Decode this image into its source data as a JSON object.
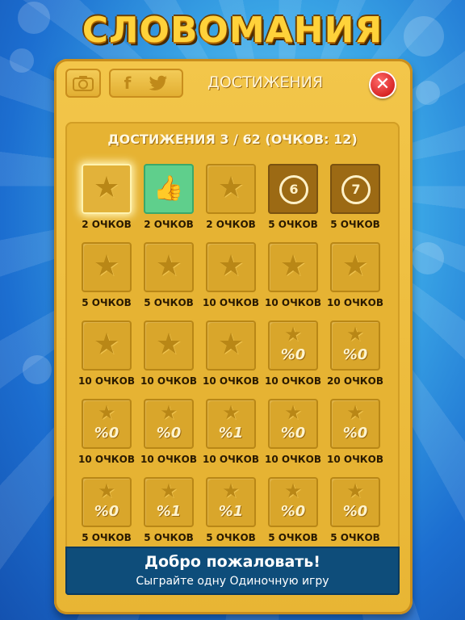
{
  "app": {
    "title": "СЛОВОМАНИЯ"
  },
  "panel": {
    "heading": "ДОСТИЖЕНИЯ",
    "summary": "ДОСТИЖЕНИЯ 3 / 62 (ОЧКОВ: 12)",
    "buttons": {
      "camera_icon": "camera-icon",
      "facebook_icon": "facebook-icon",
      "twitter_icon": "twitter-icon",
      "close_icon": "close-icon"
    }
  },
  "achievements": [
    {
      "type": "star",
      "points": "2 ОЧКОВ",
      "state": "highlighted"
    },
    {
      "type": "thumb",
      "points": "2 ОЧКОВ",
      "state": "unlocked"
    },
    {
      "type": "star",
      "points": "2 ОЧКОВ",
      "state": "locked"
    },
    {
      "type": "number",
      "number": "6",
      "points": "5 ОЧКОВ",
      "state": "unlocked"
    },
    {
      "type": "number",
      "number": "7",
      "points": "5 ОЧКОВ",
      "state": "unlocked"
    },
    {
      "type": "star",
      "points": "5 ОЧКОВ",
      "state": "locked"
    },
    {
      "type": "star",
      "points": "5 ОЧКОВ",
      "state": "locked"
    },
    {
      "type": "star",
      "points": "10 ОЧКОВ",
      "state": "locked"
    },
    {
      "type": "star",
      "points": "10 ОЧКОВ",
      "state": "locked"
    },
    {
      "type": "star",
      "points": "10 ОЧКОВ",
      "state": "locked"
    },
    {
      "type": "star",
      "points": "10 ОЧКОВ",
      "state": "locked"
    },
    {
      "type": "star",
      "points": "10 ОЧКОВ",
      "state": "locked"
    },
    {
      "type": "star",
      "points": "10 ОЧКОВ",
      "state": "locked"
    },
    {
      "type": "progress",
      "progress": "%0",
      "points": "10 ОЧКОВ",
      "state": "locked"
    },
    {
      "type": "progress",
      "progress": "%0",
      "points": "20 ОЧКОВ",
      "state": "locked"
    },
    {
      "type": "progress",
      "progress": "%0",
      "points": "10 ОЧКОВ",
      "state": "locked"
    },
    {
      "type": "progress",
      "progress": "%0",
      "points": "10 ОЧКОВ",
      "state": "locked"
    },
    {
      "type": "progress",
      "progress": "%1",
      "points": "10 ОЧКОВ",
      "state": "locked"
    },
    {
      "type": "progress",
      "progress": "%0",
      "points": "10 ОЧКОВ",
      "state": "locked"
    },
    {
      "type": "progress",
      "progress": "%0",
      "points": "10 ОЧКОВ",
      "state": "locked"
    },
    {
      "type": "progress",
      "progress": "%0",
      "points": "5 ОЧКОВ",
      "state": "locked"
    },
    {
      "type": "progress",
      "progress": "%1",
      "points": "5 ОЧКОВ",
      "state": "locked"
    },
    {
      "type": "progress",
      "progress": "%1",
      "points": "5 ОЧКОВ",
      "state": "locked"
    },
    {
      "type": "progress",
      "progress": "%0",
      "points": "5 ОЧКОВ",
      "state": "locked"
    },
    {
      "type": "progress",
      "progress": "%0",
      "points": "5 ОЧКОВ",
      "state": "locked"
    }
  ],
  "footer": {
    "title": "Добро пожаловать!",
    "subtitle": "Сыграйте одну Одиночную игру"
  },
  "colors": {
    "panel": "#f0c040",
    "footer": "#0e4d7a",
    "background": "#2a8ad8",
    "close": "#d41f1f",
    "unlocked_green": "#5fcf8c"
  }
}
